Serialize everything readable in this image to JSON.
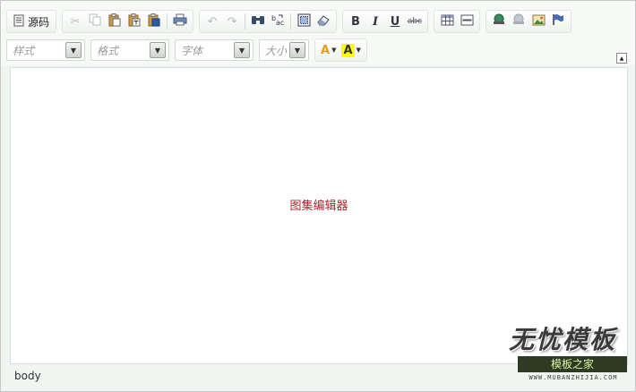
{
  "toolbar": {
    "source_label": "源码",
    "bold_label": "B",
    "italic_label": "I",
    "underline_label": "U",
    "strike_label": "abc",
    "text_color_label": "A",
    "bg_color_label": "A"
  },
  "combos": {
    "style_placeholder": "样式",
    "format_placeholder": "格式",
    "font_placeholder": "字体",
    "size_placeholder": "大小"
  },
  "editor": {
    "content_text": "图集编辑器"
  },
  "statusbar": {
    "element_path": "body"
  },
  "watermark": {
    "title": "无忧模板",
    "subtitle": "模板之家",
    "url": "WWW.MUBANZHIJIA.COM"
  },
  "colors": {
    "content_text": "#b0202a",
    "bg_highlight": "#ffff00",
    "font_color_accent": "#e0a020"
  }
}
